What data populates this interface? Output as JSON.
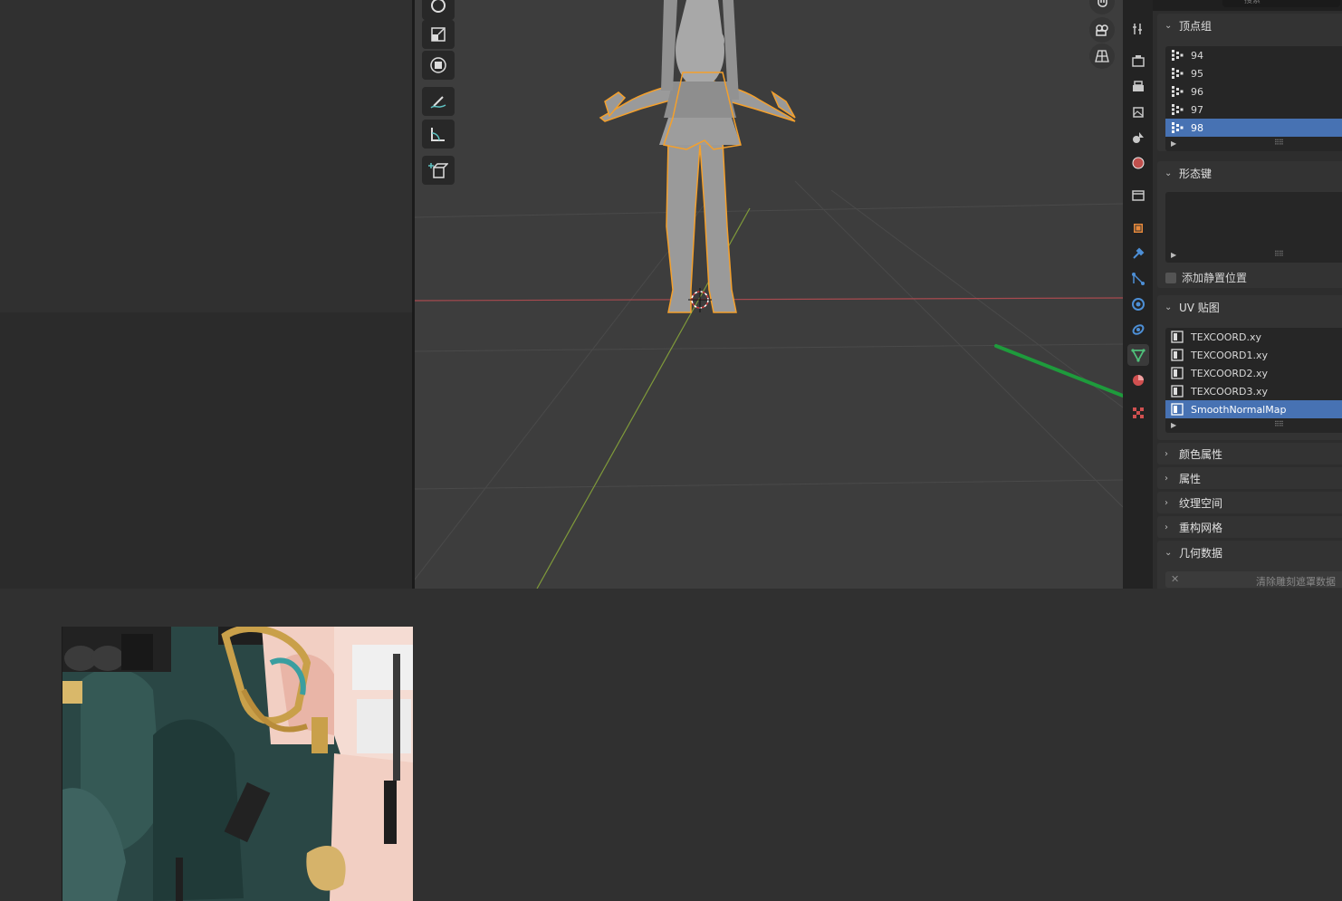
{
  "properties": {
    "search_placeholder": "搜索",
    "vertex_groups": {
      "title": "顶点组",
      "items": [
        "94",
        "95",
        "96",
        "97",
        "98"
      ],
      "selected": "98"
    },
    "shape_keys": {
      "title": "形态键",
      "add_rest_position": "添加静置位置"
    },
    "uv_maps": {
      "title": "UV 贴图",
      "items": [
        "TEXCOORD.xy",
        "TEXCOORD1.xy",
        "TEXCOORD2.xy",
        "TEXCOORD3.xy",
        "SmoothNormalMap"
      ],
      "selected": "SmoothNormalMap"
    },
    "collapsed_panels": [
      "颜色属性",
      "属性",
      "纹理空间",
      "重构网格"
    ],
    "geometry_data": {
      "title": "几何数据",
      "clear_sculpt_mask": "清除雕刻遮罩数据"
    }
  },
  "colors": {
    "selection": "#4772b3",
    "outline": "#f4a02c",
    "annotation_arrow": "#1e9b3c",
    "x_axis": "#a84a4f",
    "y_axis": "#7f9a3a"
  },
  "tabs": [
    {
      "name": "tool-tab-icon",
      "color": "#c8c8c8"
    },
    {
      "name": "render-tab-icon",
      "color": "#c8c8c8"
    },
    {
      "name": "output-tab-icon",
      "color": "#c8c8c8"
    },
    {
      "name": "view-layer-tab-icon",
      "color": "#c8c8c8"
    },
    {
      "name": "scene-tab-icon",
      "color": "#c8c8c8"
    },
    {
      "name": "world-tab-icon",
      "color": "#c0504d"
    },
    {
      "name": "collection-tab-icon",
      "color": "#c8c8c8"
    },
    {
      "name": "object-tab-icon",
      "color": "#e7883a"
    },
    {
      "name": "modifier-tab-icon",
      "color": "#4d8fd6"
    },
    {
      "name": "particles-tab-icon",
      "color": "#4d8fd6"
    },
    {
      "name": "physics-tab-icon",
      "color": "#4d8fd6"
    },
    {
      "name": "constraints-tab-icon",
      "color": "#4d8fd6"
    },
    {
      "name": "mesh-data-tab-icon",
      "color": "#4fbf7a"
    },
    {
      "name": "material-tab-icon",
      "color": "#d05050"
    },
    {
      "name": "texture-tab-icon",
      "color": "#d05050"
    }
  ]
}
